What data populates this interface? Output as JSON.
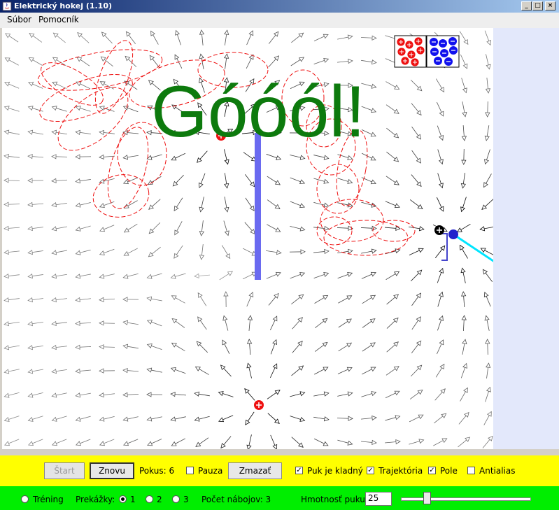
{
  "window": {
    "title": "Elektrický hokej (1.10)"
  },
  "menu": [
    "Súbor",
    "Pomocník"
  ],
  "field": {
    "goal_text": "Góóól!",
    "colors": {
      "positive": "#ee1111",
      "negative": "#1111ee",
      "wall": "#6a6af0",
      "trajectory": "#ee1111",
      "aim_line": "#00e5ff",
      "goal_text": "#0d7a0d"
    }
  },
  "controls": {
    "start_label": "Štart",
    "again_label": "Znovu",
    "attempts": "Pokus: 6",
    "pause_label": "Pauza",
    "pause_checked": false,
    "clear_label": "Zmazať",
    "positive_puck_label": "Puk je kladný",
    "positive_puck_checked": true,
    "trajectory_label": "Trajektória",
    "trajectory_checked": true,
    "field_label": "Pole",
    "field_checked": true,
    "antialias_label": "Antialias",
    "antialias_checked": false
  },
  "options": {
    "training_label": "Tréning",
    "obstacles_label": "Prekážky:",
    "levels": [
      {
        "label": "1",
        "selected": true
      },
      {
        "label": "2",
        "selected": false
      },
      {
        "label": "3",
        "selected": false
      }
    ],
    "charge_count": "Počet nábojov: 3",
    "puck_mass_label": "Hmotnosť puku",
    "puck_mass_value": "25",
    "puck_mass_slider_fraction": 0.2
  }
}
